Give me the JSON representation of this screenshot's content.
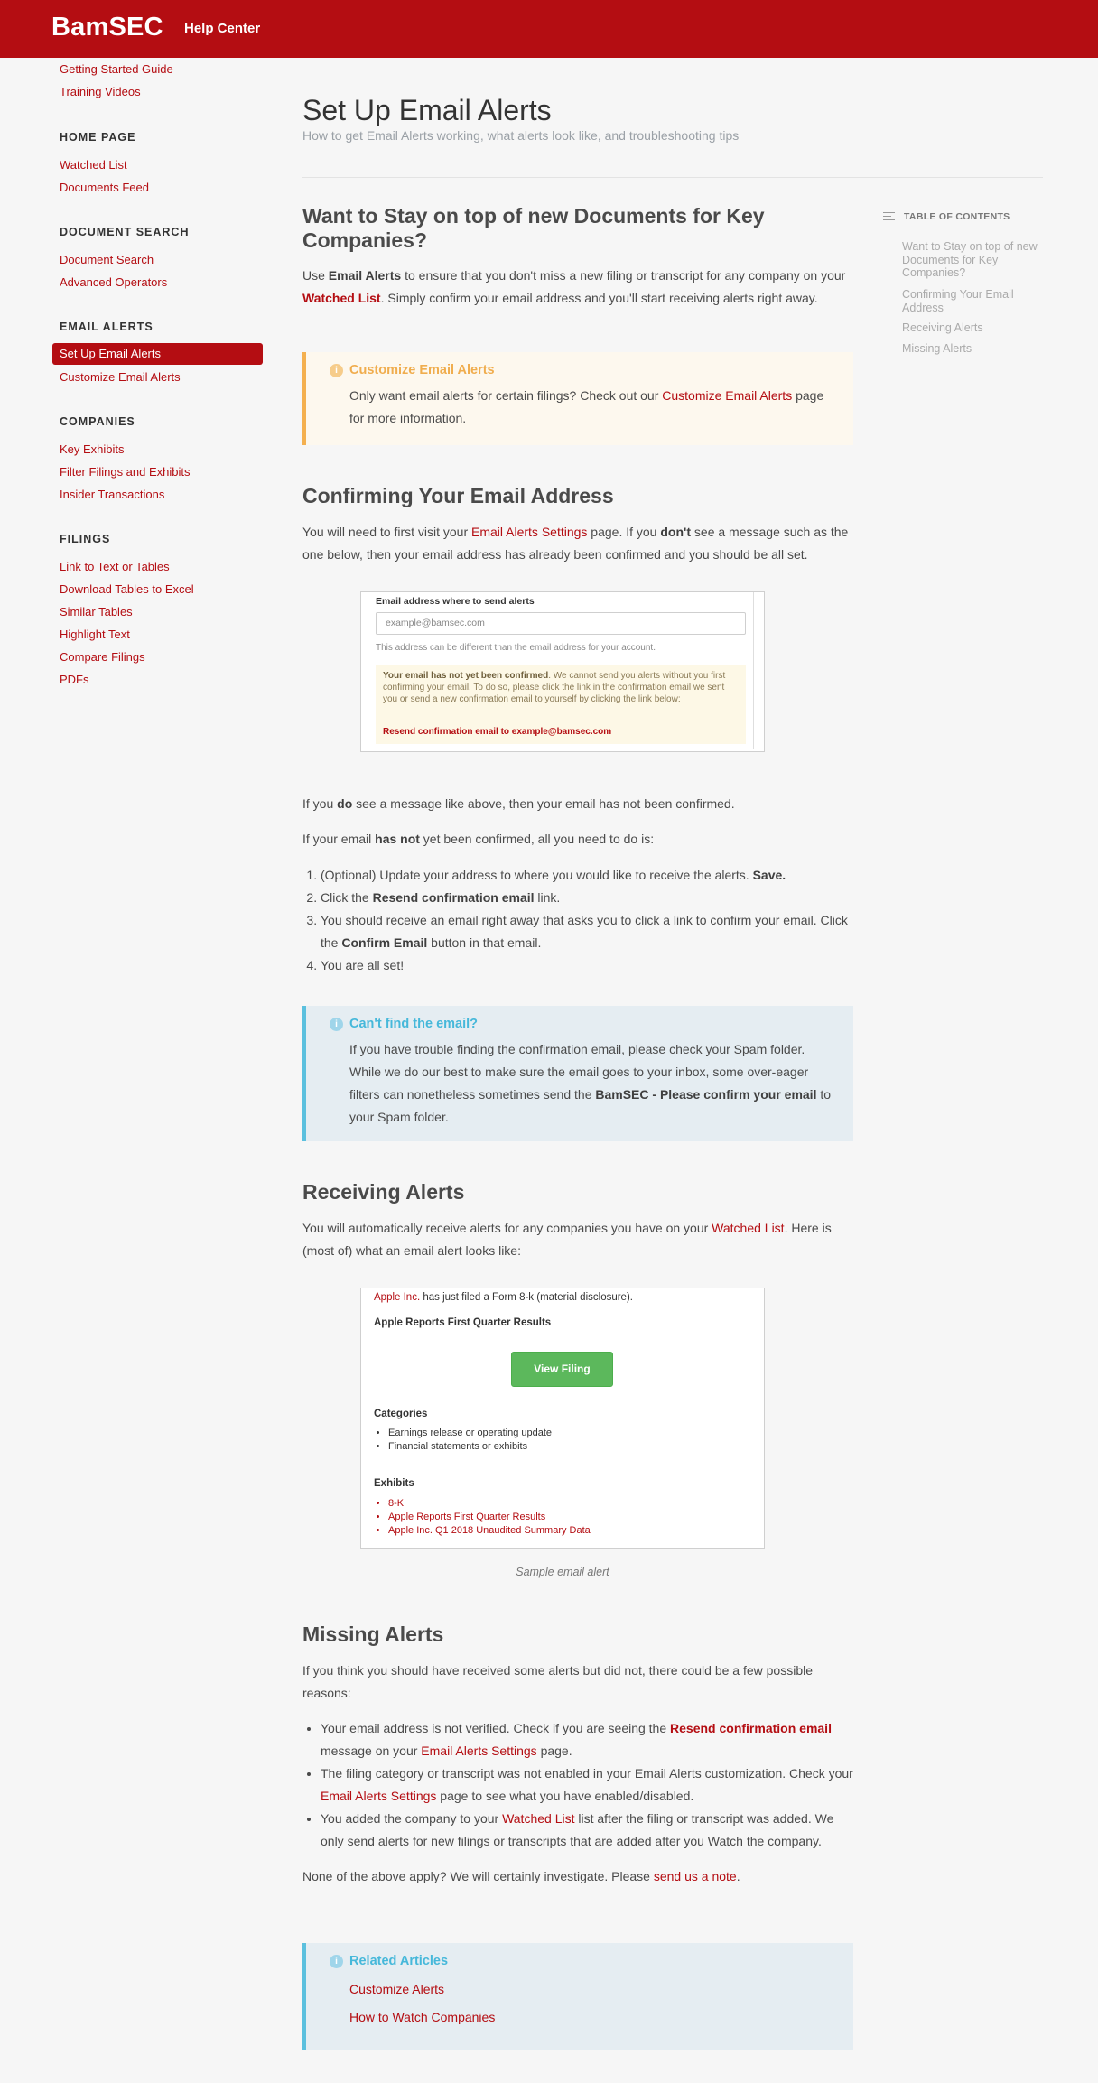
{
  "header": {
    "logo": "BamSEC",
    "help_center": "Help Center"
  },
  "sidebar": {
    "top_links": [
      "Getting Started Guide",
      "Training Videos"
    ],
    "sections": [
      {
        "title": "HOME PAGE",
        "items": [
          "Watched List",
          "Documents Feed"
        ]
      },
      {
        "title": "DOCUMENT SEARCH",
        "items": [
          "Document Search",
          "Advanced Operators"
        ]
      },
      {
        "title": "EMAIL ALERTS",
        "items": [
          "Set Up Email Alerts",
          "Customize Email Alerts"
        ],
        "active": "Set Up Email Alerts"
      },
      {
        "title": "COMPANIES",
        "items": [
          "Key Exhibits",
          "Filter Filings and Exhibits",
          "Insider Transactions"
        ]
      },
      {
        "title": "FILINGS",
        "items": [
          "Link to Text or Tables",
          "Download Tables to Excel",
          "Similar Tables",
          "Highlight Text",
          "Compare Filings",
          "PDFs"
        ]
      }
    ]
  },
  "page": {
    "title": "Set Up Email Alerts",
    "subtitle": "How to get Email Alerts working, what alerts look like, and troubleshooting tips"
  },
  "s1": {
    "heading": "Want to Stay on top of new Documents for Key Companies?",
    "p_use": "Use ",
    "p_b1": "Email Alerts",
    "p_mid": " to ensure that you don't miss a new filing or transcript for any company on your ",
    "p_link": "Watched List",
    "p_end": ". Simply confirm your email address and you'll start receiving alerts right away."
  },
  "callout_customize": {
    "title": "Customize Email Alerts",
    "t1": "Only want email alerts for certain filings? Check out our ",
    "link": "Customize Email Alerts",
    "t2": " page for more information."
  },
  "s2": {
    "heading": "Confirming Your Email Address",
    "p1a": "You will need to first visit your ",
    "p1link": "Email Alerts Settings",
    "p1b": " page. If you ",
    "p1bold": "don't",
    "p1c": " see a message such as the one below, then your email address has already been confirmed and you should be all set.",
    "p2a": "If you ",
    "p2bold": "do",
    "p2b": " see a message like above, then your email has not been confirmed.",
    "p3a": "If your email ",
    "p3bold": "has not",
    "p3b": " yet been confirmed, all you need to do is:",
    "steps": {
      "s1a": "(Optional) Update your address to where you would like to receive the alerts. ",
      "s1b": "Save.",
      "s2a": "Click the ",
      "s2b": "Resend confirmation email",
      "s2c": " link.",
      "s3a": "You should receive an email right away that asks you to click a link to confirm your email. Click the ",
      "s3b": "Confirm Email",
      "s3c": " button in that email.",
      "s4": "You are all set!"
    }
  },
  "settings_shot": {
    "label": "Email address where to send alerts",
    "placeholder": "example@bamsec.com",
    "hint": "This address can be different than the email address for your account.",
    "notice_bold": "Your email has not yet been confirmed",
    "notice_text": ". We cannot send you alerts without you first confirming your email. To do so, please click the link in the confirmation email we sent you or send a new confirmation email to yourself by clicking the link below:",
    "resend": "Resend confirmation email to example@bamsec.com"
  },
  "callout_cantfind": {
    "title": "Can't find the email?",
    "t1": "If you have trouble finding the confirmation email, please check your Spam folder. While we do our best to make sure the email goes to your inbox, some over-eager filters can nonetheless sometimes send the ",
    "bold": "BamSEC - Please confirm your email",
    "t2": " to your Spam folder."
  },
  "s3": {
    "heading": "Receiving Alerts",
    "pa": "You will automatically receive alerts for any companies you have on your ",
    "plink": "Watched List",
    "pb": ". Here is (most of) what an email alert looks like:"
  },
  "email_shot": {
    "company": "Apple Inc.",
    "line1_rest": " has just filed a Form 8-k (material disclosure).",
    "headline": "Apple Reports First Quarter Results",
    "button": "View Filing",
    "categories_title": "Categories",
    "categories": [
      "Earnings release or operating update",
      "Financial statements or exhibits"
    ],
    "exhibits_title": "Exhibits",
    "exhibits": [
      "8-K",
      "Apple Reports First Quarter Results",
      "Apple Inc. Q1 2018 Unaudited Summary Data"
    ],
    "caption": "Sample email alert"
  },
  "s4": {
    "heading": "Missing Alerts",
    "intro": "If you think you should have received some alerts but did not, there could be a few possible reasons:",
    "b1a": "Your email address is not verified. Check if you are seeing the ",
    "b1link": "Resend confirmation email",
    "b1b": " message on your ",
    "b1link2": "Email Alerts Settings",
    "b1c": " page.",
    "b2a": "The filing category or transcript was not enabled in your Email Alerts customization. Check your ",
    "b2link": "Email Alerts Settings",
    "b2b": " page to see what you have enabled/disabled.",
    "b3a": "You added the company to your ",
    "b3link": "Watched List",
    "b3b": " list after the filing or transcript was added. We only send alerts for new filings or transcripts that are added after you Watch the company.",
    "outro_a": "None of the above apply? We will certainly investigate. Please ",
    "outro_link": "send us a note",
    "outro_b": "."
  },
  "related": {
    "title": "Related Articles",
    "links": [
      "Customize Alerts",
      "How to Watch Companies"
    ]
  },
  "toc": {
    "title": "TABLE OF CONTENTS",
    "items": [
      "Want to Stay on top of new Documents for Key Companies?",
      "Confirming Your Email Address",
      "Receiving Alerts",
      "Missing Alerts"
    ]
  },
  "colors": {
    "brand": "#b40d12",
    "warn": "#f0ad4e",
    "info": "#5bc0de",
    "button_green": "#5cb85c"
  }
}
